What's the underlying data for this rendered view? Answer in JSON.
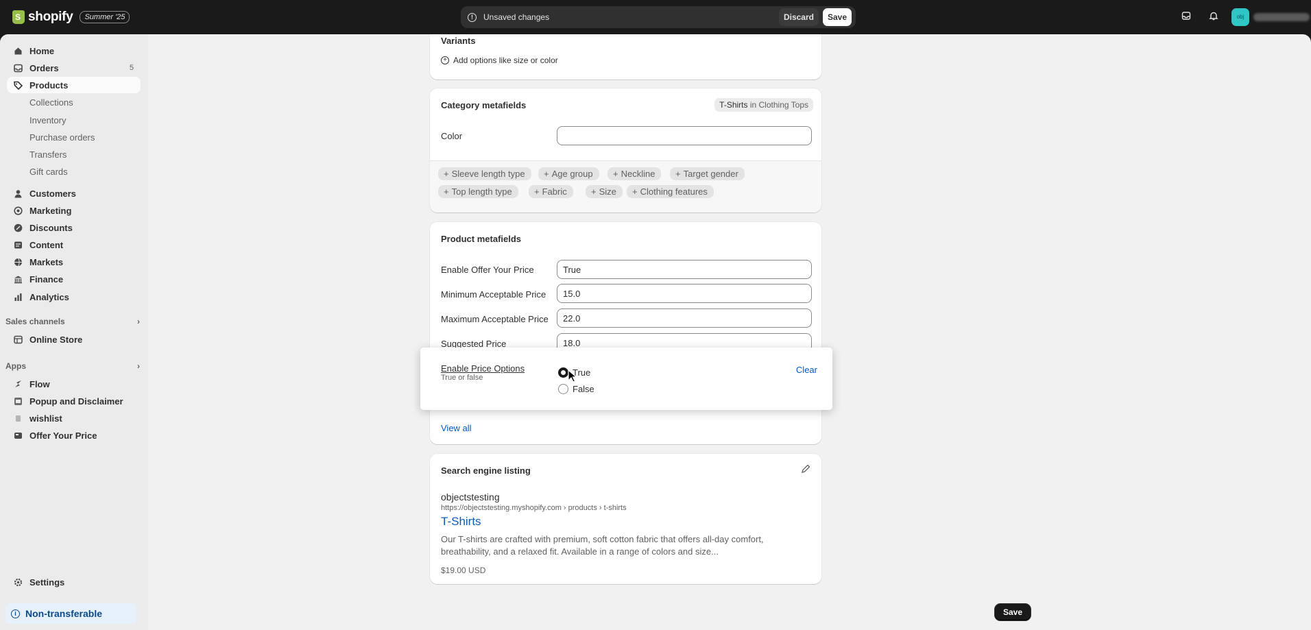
{
  "topbar": {
    "brand": "shopify",
    "edition": "Summer '25",
    "unsaved_text": "Unsaved changes",
    "discard_label": "Discard",
    "save_label": "Save",
    "store_avatar": "obj"
  },
  "sidebar": {
    "items": [
      {
        "label": "Home",
        "icon": "home-icon"
      },
      {
        "label": "Orders",
        "icon": "inbox-icon",
        "badge": "5"
      },
      {
        "label": "Products",
        "icon": "tag-icon"
      },
      {
        "label": "Collections"
      },
      {
        "label": "Inventory"
      },
      {
        "label": "Purchase orders"
      },
      {
        "label": "Transfers"
      },
      {
        "label": "Gift cards"
      },
      {
        "label": "Customers",
        "icon": "person-icon"
      },
      {
        "label": "Marketing",
        "icon": "target-icon"
      },
      {
        "label": "Discounts",
        "icon": "discount-icon"
      },
      {
        "label": "Content",
        "icon": "content-icon"
      },
      {
        "label": "Markets",
        "icon": "globe-icon"
      },
      {
        "label": "Finance",
        "icon": "bank-icon"
      },
      {
        "label": "Analytics",
        "icon": "chart-icon"
      }
    ],
    "sales_channels_label": "Sales channels",
    "online_store": "Online Store",
    "apps_label": "Apps",
    "apps": [
      "Flow",
      "Popup and Disclaimer",
      "wishlist",
      "Offer Your Price"
    ],
    "settings": "Settings",
    "non_transferable": "Non-transferable"
  },
  "variants": {
    "title": "Variants",
    "add_options": "Add options like size or color"
  },
  "category_metafields": {
    "title": "Category metafields",
    "badge_main": "T-Shirts",
    "badge_rest": " in Clothing Tops",
    "color_label": "Color",
    "color_value": "",
    "chips": [
      "Sleeve length type",
      "Age group",
      "Neckline",
      "Target gender",
      "Top length type",
      "Fabric",
      "Size",
      "Clothing features"
    ]
  },
  "product_metafields": {
    "title": "Product metafields",
    "fields": [
      {
        "label": "Enable Offer Your Price",
        "value": "True"
      },
      {
        "label": "Minimum Acceptable Price",
        "value": "15.0"
      },
      {
        "label": "Maximum Acceptable Price",
        "value": "22.0"
      },
      {
        "label": "Suggested Price",
        "value": "18.0"
      }
    ],
    "view_all": "View all"
  },
  "popover": {
    "label": "Enable Price Options",
    "sublabel": "True or false",
    "options": [
      "True",
      "False"
    ],
    "selected": "True",
    "clear": "Clear"
  },
  "seo": {
    "title": "Search engine listing",
    "store": "objectstesting",
    "url": "https://objectstesting.myshopify.com › products › t-shirts",
    "page_title": "T-Shirts",
    "description": "Our T-shirts are crafted with premium, soft cotton fabric that offers all-day comfort, breathability, and a relaxed fit. Available in a range of colors and size...",
    "price": "$19.00 USD"
  },
  "footer": {
    "save_label": "Save"
  }
}
